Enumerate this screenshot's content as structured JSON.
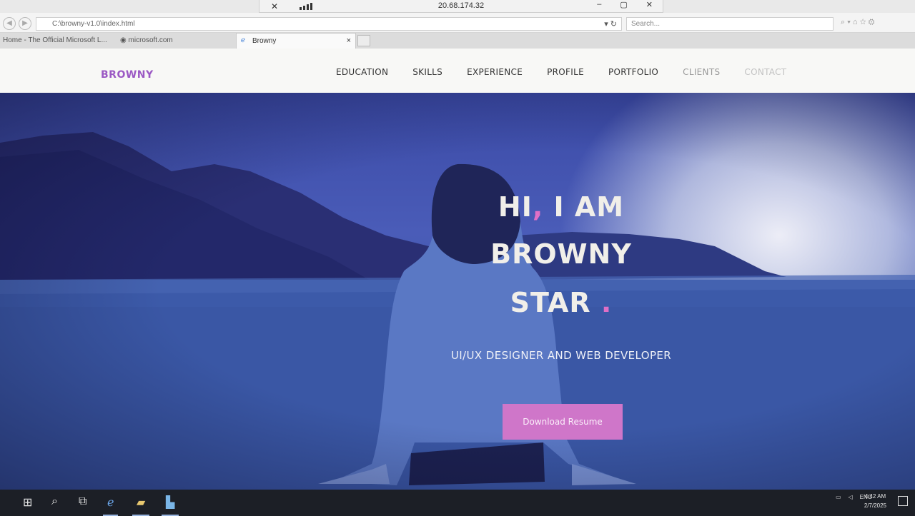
{
  "rdp": {
    "ip": "20.68.174.32",
    "pin_icon": "pin-icon",
    "signal_icon": "signal-bars-icon",
    "controls": [
      "–",
      "▢",
      "✕"
    ]
  },
  "browser": {
    "address": "C:\\browny-v1.0\\index.html",
    "search_placeholder": "Search...",
    "favorites": [
      "Home - The Official Microsoft L...",
      "microsoft.com"
    ],
    "active_tab": "Browny",
    "tab_close": "×"
  },
  "site": {
    "logo": "BROWNY",
    "menu": [
      "EDUCATION",
      "SKILLS",
      "EXPERIENCE",
      "PROFILE",
      "PORTFOLIO",
      "CLIENTS",
      "CONTACT"
    ]
  },
  "hero": {
    "line1_a": "HI",
    "line1_comma": ",",
    "line1_b": "I AM",
    "line2": "BROWNY",
    "line3": "STAR",
    "line3_dot": ".",
    "subtitle": "UI/UX DESIGNER AND WEB DEVELOPER",
    "button": "Download Resume",
    "accent_color": "#cf76c9"
  },
  "taskbar": {
    "language": "ENG",
    "time": "4:42 AM",
    "date": "2/7/2025"
  }
}
